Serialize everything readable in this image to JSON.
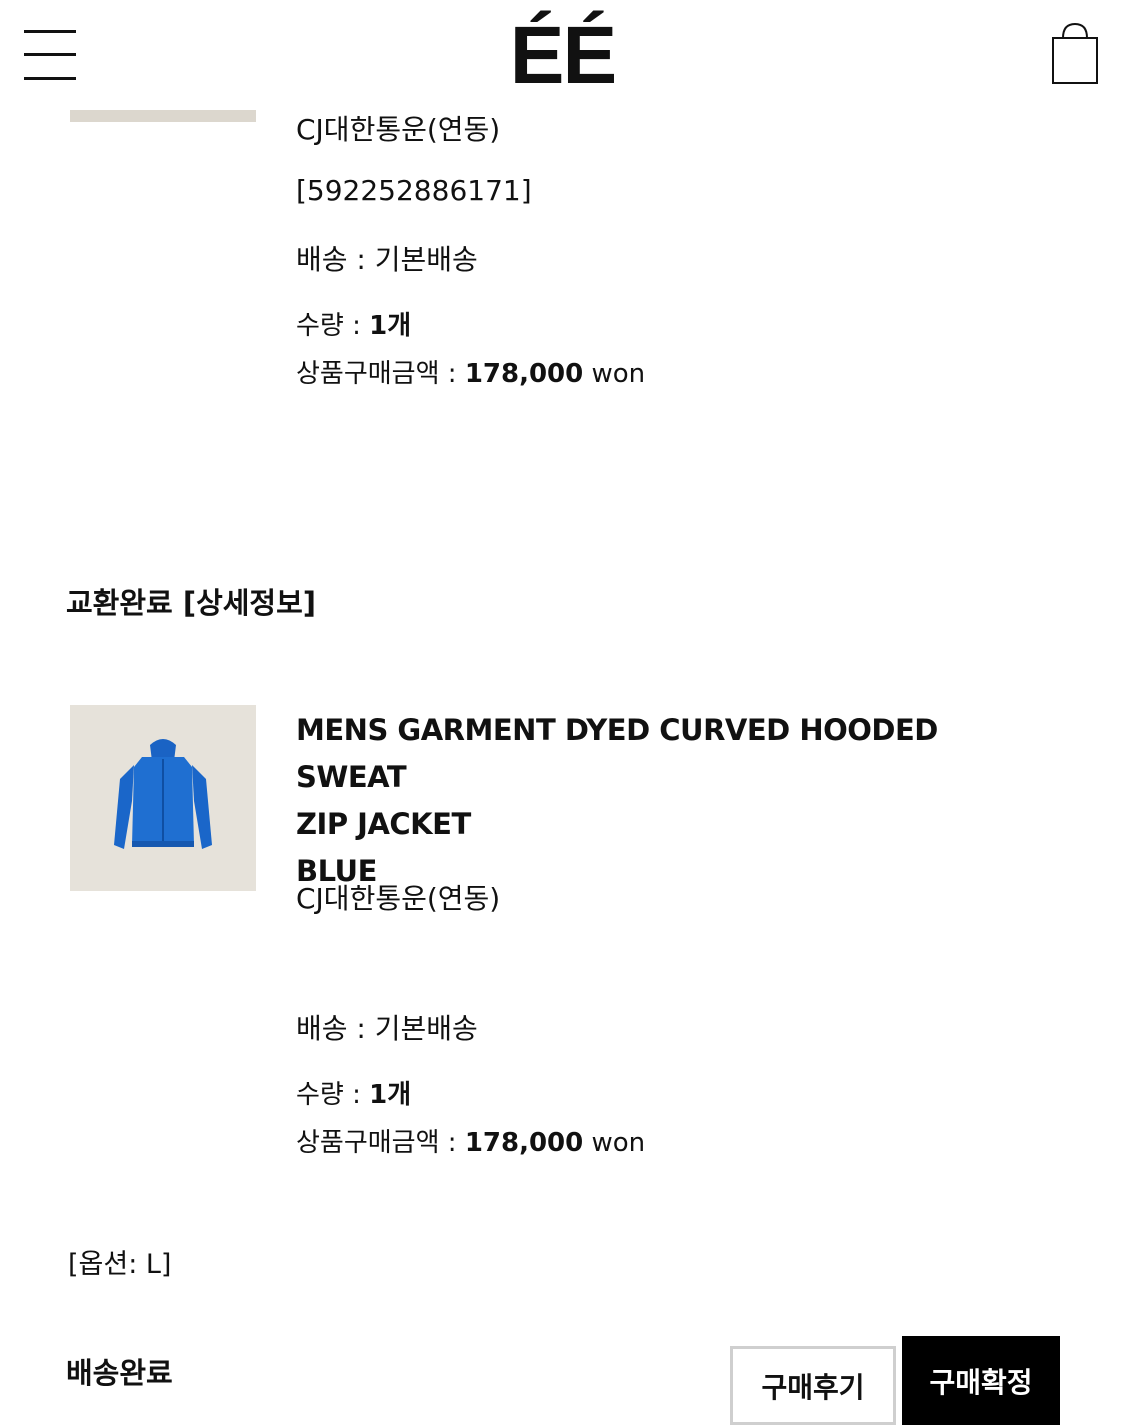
{
  "header": {
    "logo": "ÉÉ"
  },
  "order_top": {
    "carrier": "CJ대한통운(연동)",
    "tracking": "[592252886171]",
    "shipping": "배송 : 기본배송",
    "quantity_label": "수량 : ",
    "quantity_value": "1개",
    "price_label": "상품구매금액 : ",
    "price_value": "178,000",
    "price_unit": " won"
  },
  "exchange_section": {
    "label": "교환완료 [상세정보]"
  },
  "order_exchange": {
    "title_line1": "MENS GARMENT DYED CURVED HOODED SWEAT",
    "title_line2": "ZIP JACKET",
    "color": "BLUE",
    "carrier": "CJ대한통운(연동)",
    "shipping": "배송 : 기본배송",
    "quantity_label": "수량 : ",
    "quantity_value": "1개",
    "price_label": "상품구매금액 : ",
    "price_value": "178,000",
    "price_unit": " won",
    "option": "[옵션: L]",
    "status": "배송완료"
  },
  "buttons": {
    "review": "구매후기",
    "confirm": "구매확정"
  },
  "icons": {
    "menu": "hamburger-menu-icon",
    "cart": "shopping-bag-icon"
  },
  "colors": {
    "text": "#111111",
    "confirm_button_bg": "#000000",
    "product_blue": "#1f6fd1"
  }
}
